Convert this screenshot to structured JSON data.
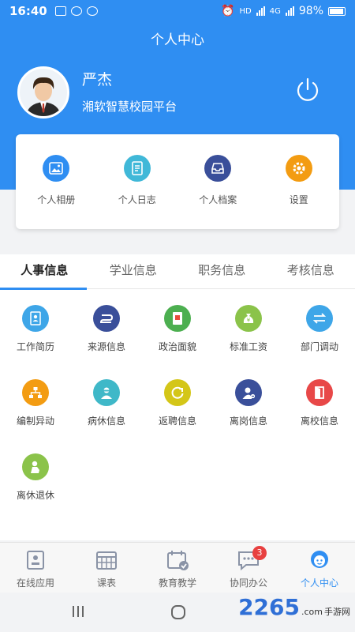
{
  "status_bar": {
    "time": "16:40",
    "network": "HD",
    "network2": "4G",
    "battery": "98%"
  },
  "header": {
    "title": "个人中心"
  },
  "profile": {
    "name": "严杰",
    "platform": "湘软智慧校园平台"
  },
  "quick_actions": [
    {
      "label": "个人相册",
      "icon": "photo-album-icon",
      "color": "#2f8ef2"
    },
    {
      "label": "个人日志",
      "icon": "journal-icon",
      "color": "#40b8d8"
    },
    {
      "label": "个人档案",
      "icon": "archive-tray-icon",
      "color": "#3a4f9a"
    },
    {
      "label": "设置",
      "icon": "gear-icon",
      "color": "#f39c12"
    }
  ],
  "tabs": [
    {
      "label": "人事信息",
      "active": true
    },
    {
      "label": "学业信息",
      "active": false
    },
    {
      "label": "职务信息",
      "active": false
    },
    {
      "label": "考核信息",
      "active": false
    }
  ],
  "grid_items": [
    {
      "label": "工作简历",
      "icon": "resume-icon",
      "color": "#3ea6e8"
    },
    {
      "label": "来源信息",
      "icon": "source-icon",
      "color": "#3a4f9a"
    },
    {
      "label": "政治面貌",
      "icon": "political-book-icon",
      "color": "#4caf50"
    },
    {
      "label": "标准工资",
      "icon": "money-bag-icon",
      "color": "#8bc34a"
    },
    {
      "label": "部门调动",
      "icon": "transfer-arrows-icon",
      "color": "#3ea6e8"
    },
    {
      "label": "编制异动",
      "icon": "org-chart-icon",
      "color": "#f39c12"
    },
    {
      "label": "病休信息",
      "icon": "sick-leave-icon",
      "color": "#3fb8c8"
    },
    {
      "label": "返聘信息",
      "icon": "rehire-icon",
      "color": "#d4c618"
    },
    {
      "label": "离岗信息",
      "icon": "leave-post-icon",
      "color": "#3a4f9a"
    },
    {
      "label": "离校信息",
      "icon": "exit-door-icon",
      "color": "#e84848"
    },
    {
      "label": "离休退休",
      "icon": "retire-icon",
      "color": "#8bc34a"
    }
  ],
  "bottom_nav": [
    {
      "label": "在线应用",
      "icon": "online-app-icon",
      "active": false,
      "badge": ""
    },
    {
      "label": "课表",
      "icon": "timetable-icon",
      "active": false,
      "badge": ""
    },
    {
      "label": "教育教学",
      "icon": "education-calendar-icon",
      "active": false,
      "badge": ""
    },
    {
      "label": "协同办公",
      "icon": "chat-icon",
      "active": false,
      "badge": "3"
    },
    {
      "label": "个人中心",
      "icon": "profile-center-icon",
      "active": true,
      "badge": ""
    }
  ],
  "watermark": {
    "number": "2265",
    "suffix": ".com",
    "text": "手游网"
  }
}
